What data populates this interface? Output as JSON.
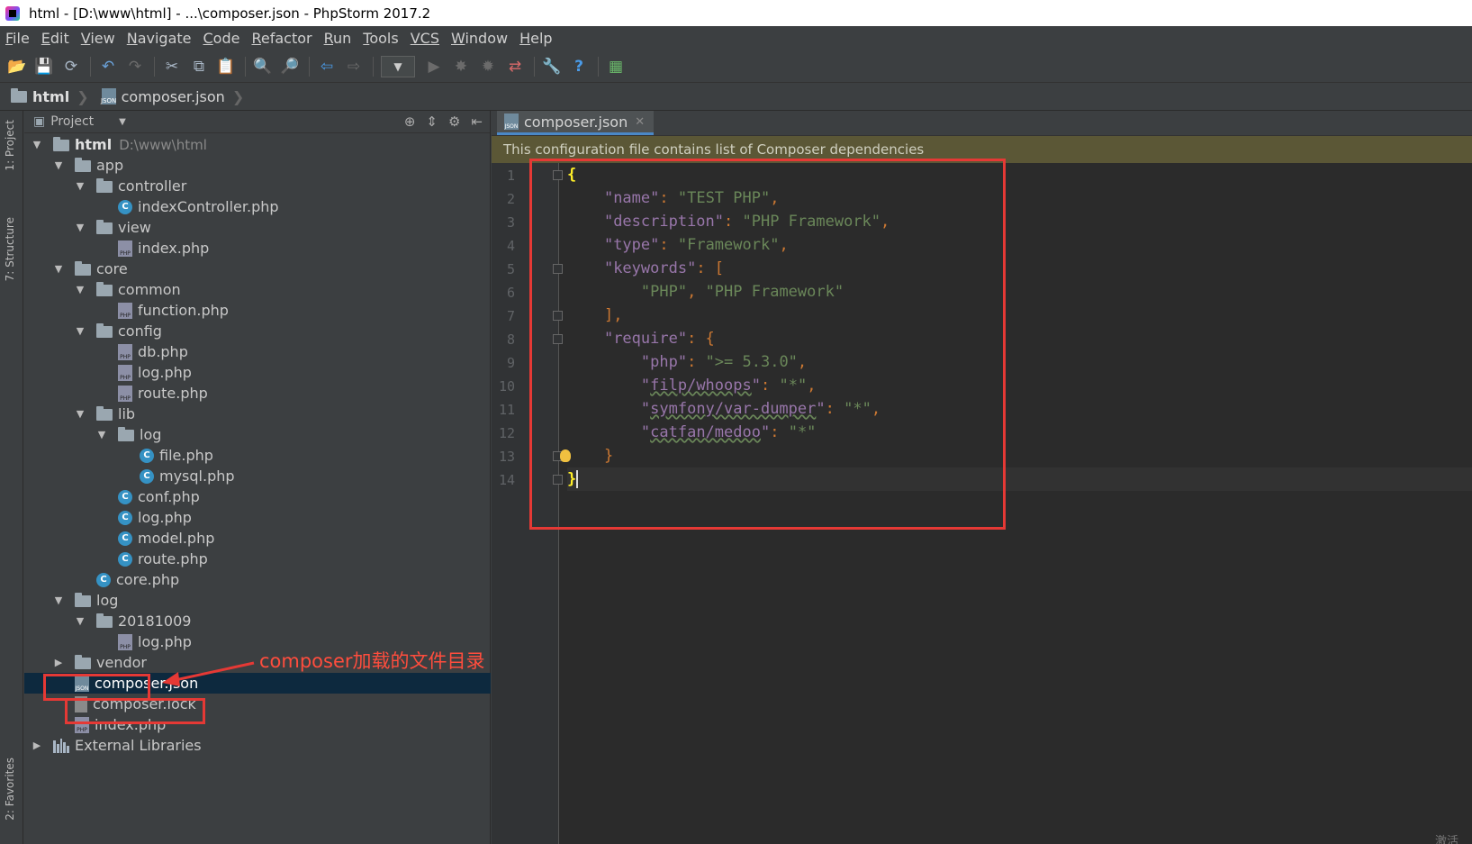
{
  "window": {
    "title": "html - [D:\\www\\html] - ...\\composer.json - PhpStorm 2017.2"
  },
  "menu": [
    {
      "m": "F",
      "rest": "ile"
    },
    {
      "m": "E",
      "rest": "dit"
    },
    {
      "m": "V",
      "rest": "iew"
    },
    {
      "m": "N",
      "rest": "avigate"
    },
    {
      "m": "C",
      "rest": "ode"
    },
    {
      "m": "R",
      "rest": "efactor"
    },
    {
      "m": "R",
      "rest": "un",
      "pre": ""
    },
    {
      "m": "T",
      "rest": "ools"
    },
    {
      "m": "VCS",
      "rest": ""
    },
    {
      "m": "W",
      "rest": "indow"
    },
    {
      "m": "H",
      "rest": "elp"
    }
  ],
  "toolbar_icons": [
    "open-icon",
    "save-icon",
    "sync-icon",
    "undo-icon",
    "redo-icon",
    "cut-icon",
    "copy-icon",
    "paste-icon",
    "find-icon",
    "replace-icon",
    "back-icon",
    "forward-icon",
    "run-config-combo",
    "run-icon",
    "debug-icon",
    "coverage-icon",
    "vcs-icon",
    "settings-icon",
    "help-icon",
    "plugin-icon"
  ],
  "breadcrumb": {
    "root": "html",
    "file": "composer.json"
  },
  "sidestrip": {
    "project": "1: Project",
    "structure": "7: Structure",
    "favorites": "2: Favorites"
  },
  "project": {
    "header": "Project",
    "tree": [
      {
        "depth": 0,
        "arrow": "down",
        "icon": "folder",
        "label": "html",
        "hint": "D:\\www\\html",
        "bold": true
      },
      {
        "depth": 1,
        "arrow": "down",
        "icon": "folder",
        "label": "app"
      },
      {
        "depth": 2,
        "arrow": "down",
        "icon": "folder",
        "label": "controller"
      },
      {
        "depth": 3,
        "arrow": "",
        "icon": "class",
        "label": "indexController.php"
      },
      {
        "depth": 2,
        "arrow": "down",
        "icon": "folder",
        "label": "view"
      },
      {
        "depth": 3,
        "arrow": "",
        "icon": "php",
        "label": "index.php"
      },
      {
        "depth": 1,
        "arrow": "down",
        "icon": "folder",
        "label": "core"
      },
      {
        "depth": 2,
        "arrow": "down",
        "icon": "folder",
        "label": "common"
      },
      {
        "depth": 3,
        "arrow": "",
        "icon": "php",
        "label": "function.php"
      },
      {
        "depth": 2,
        "arrow": "down",
        "icon": "folder",
        "label": "config"
      },
      {
        "depth": 3,
        "arrow": "",
        "icon": "php",
        "label": "db.php"
      },
      {
        "depth": 3,
        "arrow": "",
        "icon": "php",
        "label": "log.php"
      },
      {
        "depth": 3,
        "arrow": "",
        "icon": "php",
        "label": "route.php"
      },
      {
        "depth": 2,
        "arrow": "down",
        "icon": "folder",
        "label": "lib"
      },
      {
        "depth": 3,
        "arrow": "down",
        "icon": "folder",
        "label": "log"
      },
      {
        "depth": 4,
        "arrow": "",
        "icon": "class",
        "label": "file.php"
      },
      {
        "depth": 4,
        "arrow": "",
        "icon": "class",
        "label": "mysql.php"
      },
      {
        "depth": 3,
        "arrow": "",
        "icon": "class",
        "label": "conf.php"
      },
      {
        "depth": 3,
        "arrow": "",
        "icon": "class",
        "label": "log.php"
      },
      {
        "depth": 3,
        "arrow": "",
        "icon": "class",
        "label": "model.php"
      },
      {
        "depth": 3,
        "arrow": "",
        "icon": "class",
        "label": "route.php"
      },
      {
        "depth": 2,
        "arrow": "",
        "icon": "class",
        "label": "core.php"
      },
      {
        "depth": 1,
        "arrow": "down",
        "icon": "folder",
        "label": "log"
      },
      {
        "depth": 2,
        "arrow": "down",
        "icon": "folder",
        "label": "20181009"
      },
      {
        "depth": 3,
        "arrow": "",
        "icon": "php",
        "label": "log.php"
      },
      {
        "depth": 1,
        "arrow": "right",
        "icon": "folder",
        "label": "vendor"
      },
      {
        "depth": 1,
        "arrow": "",
        "icon": "json",
        "label": "composer.json",
        "selected": true
      },
      {
        "depth": 1,
        "arrow": "",
        "icon": "lock",
        "label": "composer.lock"
      },
      {
        "depth": 1,
        "arrow": "",
        "icon": "php",
        "label": "index.php"
      },
      {
        "depth": 0,
        "arrow": "right",
        "icon": "lib",
        "label": "External Libraries"
      }
    ]
  },
  "editor": {
    "tab": "composer.json",
    "notice": "This configuration file contains list of Composer dependencies",
    "line_numbers": [
      "1",
      "2",
      "3",
      "4",
      "5",
      "6",
      "7",
      "8",
      "9",
      "10",
      "11",
      "12",
      "13",
      "14"
    ]
  },
  "annotation": {
    "text": "composer加载的文件目录"
  },
  "corner": "激活"
}
